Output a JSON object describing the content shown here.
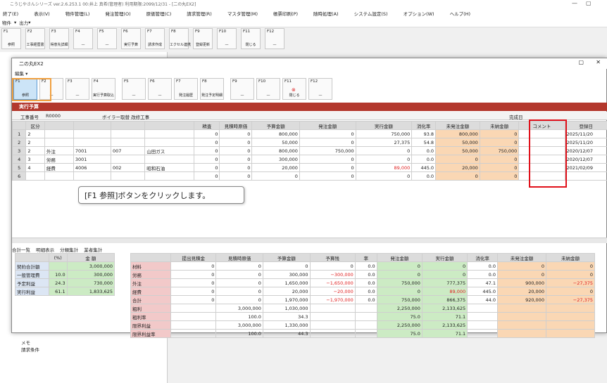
{
  "titlebar": {
    "text": "こうじやさんシリーズ  ver.2.6.253.1  00:井上 真希(管理者)    利用期限:2099/12/31 - [二の丸EX2]",
    "min": "—",
    "max": "▢"
  },
  "menubar": [
    "終了(E)",
    "表示(V)",
    "物件管理(L)",
    "発注管理(O)",
    "原価管理(C)",
    "請求管理(R)",
    "マスタ管理(M)",
    "帳票印刷(P)",
    "随時処理(A)",
    "システム設定(S)",
    "オプション(W)",
    "ヘルプ(H)"
  ],
  "subbar": {
    "a": "物件",
    "b": "出力"
  },
  "mainkeys": [
    {
      "n": "F1",
      "l": "参照"
    },
    {
      "n": "F2",
      "l": "工事経歴書"
    },
    {
      "n": "F3",
      "l": "得意先詳細"
    },
    {
      "n": "F4",
      "l": "—"
    },
    {
      "n": "F5",
      "l": "—"
    },
    {
      "n": "F6",
      "l": "実行予算"
    },
    {
      "n": "F7",
      "l": "請求作成"
    },
    {
      "n": "F8",
      "l": "エクセル連携"
    },
    {
      "n": "F9",
      "l": "登録更新"
    },
    {
      "n": "F10",
      "l": "—"
    },
    {
      "n": "F11",
      "l": "閉じる"
    },
    {
      "n": "F12",
      "l": "—"
    }
  ],
  "dialog": {
    "title": "二の丸EX2",
    "menu": "編集 ▾",
    "keys": [
      {
        "n": "F1",
        "l": "参照"
      },
      {
        "n": "F2",
        "l": "—"
      },
      {
        "n": "F3",
        "l": "—"
      },
      {
        "n": "F4",
        "l": "実行予算取込"
      },
      {
        "n": "F5",
        "l": "—"
      },
      {
        "n": "F6",
        "l": "—"
      },
      {
        "n": "F7",
        "l": "発注履歴"
      },
      {
        "n": "F8",
        "l": "発注予定明細"
      },
      {
        "n": "F9",
        "l": "—"
      },
      {
        "n": "F10",
        "l": "—"
      },
      {
        "n": "F11",
        "l": "閉じる"
      },
      {
        "n": "F12",
        "l": "—"
      }
    ],
    "section": "実行予算",
    "job_label": "工事番号",
    "job_no": "R0000",
    "job_name": "ボイラー取替 改修工事",
    "done_label": "完成日",
    "headers": [
      "区分",
      "",
      "",
      "",
      "",
      "精査",
      "見積時原価",
      "予算金額",
      "発注金額",
      "実行金額",
      "消化率",
      "未発注金額",
      "未納金額",
      "コメント",
      "登録日"
    ],
    "rows": [
      [
        "1",
        "2",
        "",
        "",
        "",
        "",
        "0",
        "0",
        "800,000",
        "0",
        "750,000",
        "93.8",
        "800,000",
        "0",
        "",
        "2025/11/20"
      ],
      [
        "2",
        "2",
        "",
        "",
        "",
        "",
        "0",
        "0",
        "50,000",
        "0",
        "27,375",
        "54.8",
        "50,000",
        "0",
        "",
        "2025/11/20"
      ],
      [
        "3",
        "2",
        "外注",
        "7001",
        "007",
        "山田ガス",
        "0",
        "0",
        "800,000",
        "750,000",
        "0",
        "0.0",
        "50,000",
        "750,000",
        "",
        "2020/12/07"
      ],
      [
        "4",
        "3",
        "労務",
        "3001",
        "",
        "",
        "0",
        "0",
        "300,000",
        "0",
        "0",
        "0.0",
        "0",
        "0",
        "",
        "2020/12/07"
      ],
      [
        "5",
        "4",
        "経費",
        "4006",
        "002",
        "昭和石油",
        "0",
        "0",
        "20,000",
        "0",
        "89,000",
        "445.0",
        "20,000",
        "0",
        "",
        "2021/02/09"
      ],
      [
        "6",
        "",
        "",
        "",
        "",
        "",
        "0",
        "0",
        "0",
        "0",
        "0",
        "0.0",
        "0",
        "0",
        "",
        ""
      ]
    ],
    "tooltip": "[F1 参照]ボタンをクリックします。",
    "tabs": [
      "合計一覧",
      "明細表示",
      "分類集計",
      "業者集計"
    ],
    "sum_left": {
      "headers": [
        "",
        "(%)",
        "金 額"
      ],
      "rows": [
        [
          "契約合計額",
          "",
          "3,000,000"
        ],
        [
          "一般管理費",
          "10.0",
          "300,000"
        ],
        [
          "予定利益",
          "24.3",
          "730,000"
        ],
        [
          "実行利益",
          "61.1",
          "1,833,625"
        ]
      ]
    },
    "sum_right": {
      "headers": [
        "",
        "提出見積金",
        "見積時原価",
        "予算金額",
        "予算残",
        "率",
        "発注金額",
        "実行金額",
        "消化率",
        "未発注金額",
        "未納金額"
      ],
      "rows": [
        [
          "材料",
          "0",
          "0",
          "0",
          "0",
          "0.0",
          "0",
          "0",
          "0.0",
          "0",
          "0"
        ],
        [
          "労務",
          "0",
          "0",
          "300,000",
          "−300,000",
          "0.0",
          "0",
          "0",
          "0.0",
          "0",
          "0"
        ],
        [
          "外注",
          "0",
          "0",
          "1,650,000",
          "−1,650,000",
          "0.0",
          "750,000",
          "777,375",
          "47.1",
          "900,000",
          "−27,375"
        ],
        [
          "経費",
          "0",
          "0",
          "20,000",
          "−20,000",
          "0.0",
          "0",
          "89,000",
          "445.0",
          "20,000",
          "0"
        ],
        [
          "合計",
          "0",
          "0",
          "1,970,000",
          "−1,970,000",
          "0.0",
          "750,000",
          "866,375",
          "44.0",
          "920,000",
          "−27,375"
        ],
        [
          "粗利",
          "",
          "3,000,000",
          "1,030,000",
          "",
          "",
          "2,250,000",
          "2,133,625",
          "",
          "",
          ""
        ],
        [
          "粗利率",
          "",
          "100.0",
          "34.3",
          "",
          "",
          "75.0",
          "71.1",
          "",
          "",
          ""
        ],
        [
          "限界利益",
          "",
          "3,000,000",
          "1,330,000",
          "",
          "",
          "2,250,000",
          "2,133,625",
          "",
          "",
          ""
        ],
        [
          "限界利益率",
          "",
          "100.0",
          "44.3",
          "",
          "",
          "75.0",
          "71.1",
          "",
          "",
          ""
        ]
      ]
    }
  },
  "leftpanel": {
    "memo": "メモ",
    "cond": "請求条件"
  }
}
